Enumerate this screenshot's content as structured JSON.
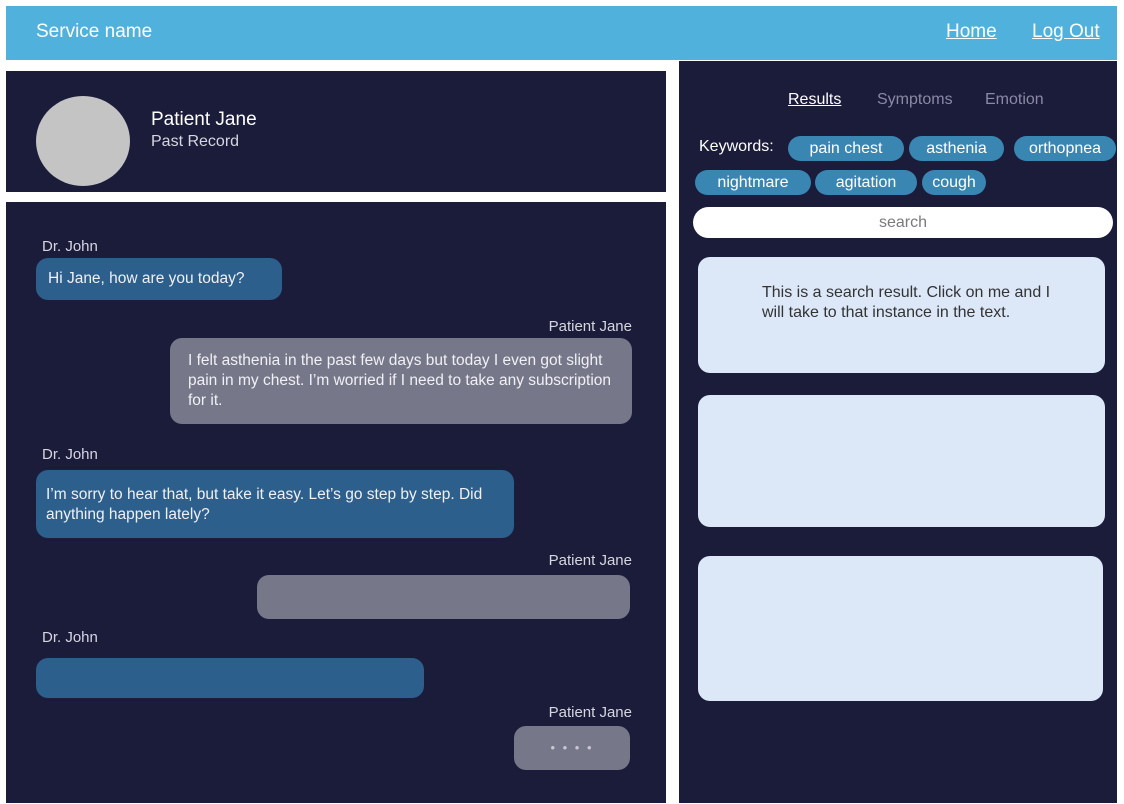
{
  "header": {
    "service_name": "Service name",
    "home": "Home",
    "logout": "Log Out"
  },
  "profile": {
    "name": "Patient Jane",
    "subtitle": "Past Record"
  },
  "chat": {
    "messages": [
      {
        "speaker": "Dr. John",
        "text": "Hi Jane, how are you today?"
      },
      {
        "speaker": "Patient Jane",
        "text": "I felt asthenia in the past few days but today I even got slight pain in my chest. I’m worried if I need to take any subscription for it."
      },
      {
        "speaker": "Dr. John",
        "text": "I’m sorry to hear that, but take it easy. Let’s go step by step. Did anything happen lately?"
      },
      {
        "speaker": "Patient Jane",
        "text": ""
      },
      {
        "speaker": "Dr. John",
        "text": ""
      },
      {
        "speaker": "Patient Jane",
        "text": "• • • •"
      }
    ]
  },
  "panel": {
    "tabs": [
      "Results",
      "Symptoms",
      "Emotion"
    ],
    "active_tab": "Results",
    "keywords_label": "Keywords:",
    "keywords": [
      "pain chest",
      "asthenia",
      "orthopnea",
      "nightmare",
      "agitation",
      "cough"
    ],
    "search_placeholder": "search",
    "results": [
      "This is a search result. Click on me and I will take to that instance in the text.",
      "",
      ""
    ]
  },
  "colors": {
    "topbar": "#4fb1dc",
    "panel_bg": "#1b1b3a",
    "doctor_bubble": "#2c5f8c",
    "patient_bubble": "#76788a",
    "chip": "#3a86b3",
    "result_card": "#dce8f8"
  }
}
